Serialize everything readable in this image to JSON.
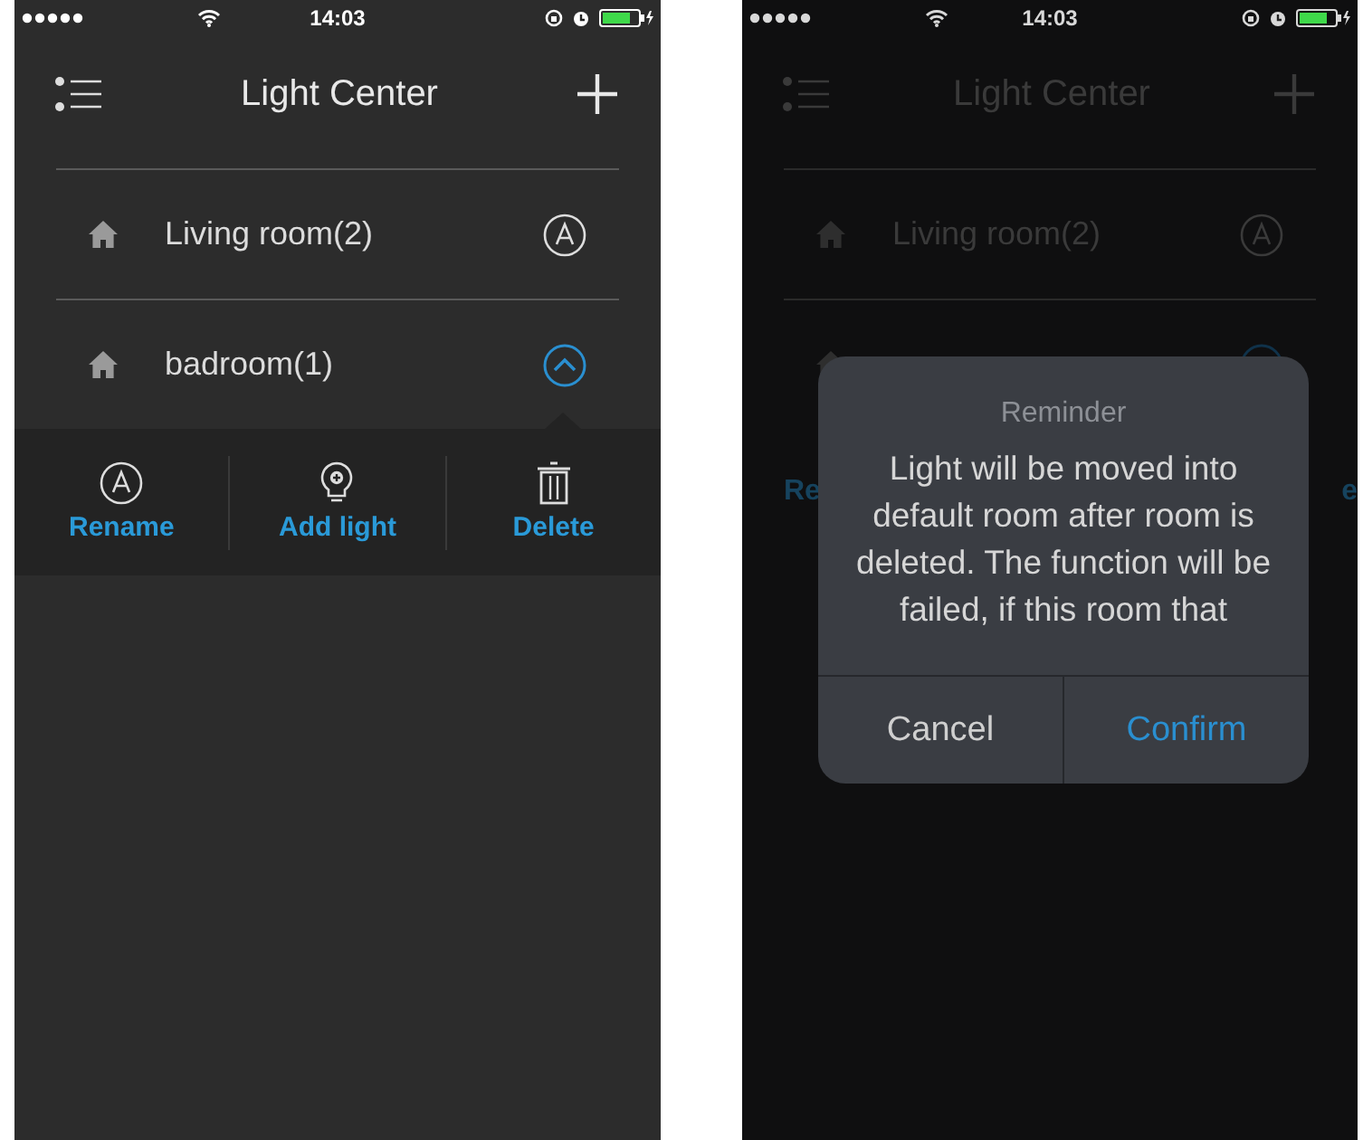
{
  "screens": [
    {
      "dimmed": false,
      "status": {
        "time": "14:03"
      },
      "title": "Light Center",
      "rooms": [
        {
          "name": "Living room(2)",
          "expanded": false
        },
        {
          "name": "badroom(1)",
          "expanded": true
        }
      ],
      "actions": [
        {
          "kind": "rename",
          "label": "Rename"
        },
        {
          "kind": "add",
          "label": "Add light"
        },
        {
          "kind": "delete",
          "label": "Delete"
        }
      ]
    },
    {
      "dimmed": true,
      "status": {
        "time": "14:03"
      },
      "title": "Light Center",
      "rooms": [
        {
          "name": "Living room(2)",
          "expanded": false
        },
        {
          "expanded": true
        }
      ],
      "action_fragments": [
        "Re",
        "e"
      ],
      "dialog": {
        "title": "Reminder",
        "message": "Light will be moved into default room after room is deleted. The function will be failed, if this room that",
        "buttons": [
          {
            "kind": "cancel",
            "label": "Cancel"
          },
          {
            "kind": "confirm",
            "label": "Confirm"
          }
        ]
      }
    }
  ]
}
